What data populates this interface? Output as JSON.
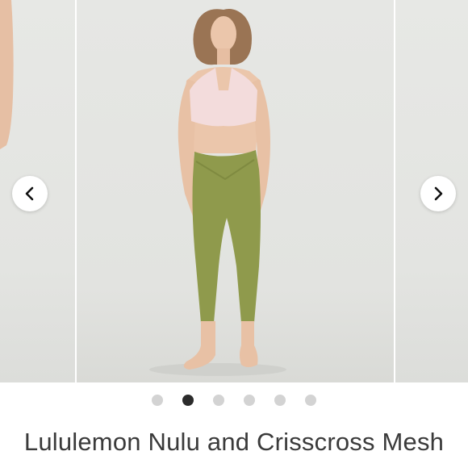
{
  "carousel": {
    "prev_label": "previous image",
    "next_label": "next image",
    "dots": [
      {
        "active": false
      },
      {
        "active": true
      },
      {
        "active": false
      },
      {
        "active": false
      },
      {
        "active": false
      },
      {
        "active": false
      }
    ]
  },
  "product": {
    "title": "Lululemon Nulu and Crisscross Mesh"
  },
  "colors": {
    "bra": "#f3dcdc",
    "leggings": "#8f9a4c",
    "skin": "#e9c3a8",
    "background": "#e6e7e4",
    "active_dot": "#2b2b2b",
    "inactive_dot": "#d3d3d3"
  }
}
